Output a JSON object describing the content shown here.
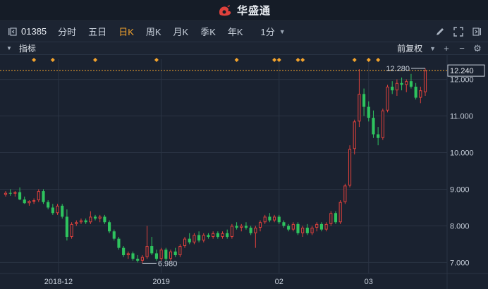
{
  "app": {
    "name": "华盛通"
  },
  "toolbar": {
    "stock_code": "01385",
    "tabs": [
      {
        "label": "分时",
        "active": false
      },
      {
        "label": "五日",
        "active": false
      },
      {
        "label": "日K",
        "active": true
      },
      {
        "label": "周K",
        "active": false
      },
      {
        "label": "月K",
        "active": false
      },
      {
        "label": "季K",
        "active": false
      },
      {
        "label": "年K",
        "active": false
      }
    ],
    "interval": "1分"
  },
  "subbar": {
    "indicator_label": "指标",
    "adjust_label": "前复权"
  },
  "colors": {
    "up": "#e0413c",
    "down": "#2ec35e",
    "accent": "#f3a32c",
    "bg": "#1a2230",
    "grid": "#2a3444"
  },
  "chart_data": {
    "type": "candlestick",
    "ylim": [
      6.7,
      12.55
    ],
    "y_ticks": [
      "12.000",
      "11.000",
      "10.000",
      "9.000",
      "8.000",
      "7.000"
    ],
    "x_ticks": [
      "2018-12",
      "2019",
      "02",
      "03"
    ],
    "current_price": "12.240",
    "max_label": "12.280",
    "min_label": "6.980",
    "candles": [
      [
        8.85,
        8.95,
        8.8,
        8.9
      ],
      [
        8.9,
        9.0,
        8.82,
        8.88
      ],
      [
        8.88,
        8.95,
        8.8,
        8.92
      ],
      [
        8.92,
        9.05,
        8.7,
        8.72
      ],
      [
        8.72,
        8.8,
        8.6,
        8.62
      ],
      [
        8.62,
        8.7,
        8.55,
        8.68
      ],
      [
        8.68,
        8.75,
        8.6,
        8.7
      ],
      [
        8.7,
        9.0,
        8.65,
        8.95
      ],
      [
        8.95,
        9.0,
        8.6,
        8.65
      ],
      [
        8.65,
        8.7,
        8.45,
        8.5
      ],
      [
        8.5,
        8.6,
        8.3,
        8.35
      ],
      [
        8.35,
        8.6,
        8.3,
        8.55
      ],
      [
        8.55,
        8.6,
        8.2,
        8.25
      ],
      [
        8.25,
        8.45,
        7.6,
        7.7
      ],
      [
        7.7,
        8.1,
        7.65,
        8.05
      ],
      [
        8.05,
        8.15,
        8.0,
        8.1
      ],
      [
        8.1,
        8.2,
        8.05,
        8.15
      ],
      [
        8.15,
        8.2,
        8.05,
        8.1
      ],
      [
        8.1,
        8.4,
        8.05,
        8.25
      ],
      [
        8.25,
        8.3,
        8.15,
        8.2
      ],
      [
        8.2,
        8.3,
        8.1,
        8.25
      ],
      [
        8.25,
        8.3,
        8.05,
        8.1
      ],
      [
        8.1,
        8.15,
        7.8,
        7.85
      ],
      [
        7.85,
        7.9,
        7.6,
        7.65
      ],
      [
        7.65,
        7.7,
        7.35,
        7.4
      ],
      [
        7.4,
        7.45,
        7.15,
        7.2
      ],
      [
        7.2,
        7.3,
        7.1,
        7.25
      ],
      [
        7.25,
        7.3,
        7.05,
        7.1
      ],
      [
        7.1,
        7.2,
        7.0,
        7.05
      ],
      [
        7.05,
        7.2,
        6.98,
        7.15
      ],
      [
        7.15,
        8.0,
        7.1,
        7.45
      ],
      [
        7.45,
        7.7,
        7.2,
        7.25
      ],
      [
        7.25,
        7.35,
        7.05,
        7.1
      ],
      [
        7.1,
        7.4,
        7.05,
        7.35
      ],
      [
        7.35,
        7.4,
        7.05,
        7.1
      ],
      [
        7.1,
        7.35,
        7.05,
        7.3
      ],
      [
        7.3,
        7.4,
        7.15,
        7.2
      ],
      [
        7.2,
        7.5,
        7.15,
        7.45
      ],
      [
        7.45,
        7.7,
        7.4,
        7.65
      ],
      [
        7.65,
        7.8,
        7.5,
        7.55
      ],
      [
        7.55,
        7.8,
        7.5,
        7.75
      ],
      [
        7.75,
        7.85,
        7.55,
        7.6
      ],
      [
        7.6,
        7.8,
        7.55,
        7.75
      ],
      [
        7.75,
        7.8,
        7.65,
        7.7
      ],
      [
        7.7,
        7.85,
        7.65,
        7.8
      ],
      [
        7.8,
        7.85,
        7.65,
        7.7
      ],
      [
        7.7,
        7.85,
        7.65,
        7.8
      ],
      [
        7.8,
        7.9,
        7.65,
        7.7
      ],
      [
        7.7,
        8.05,
        7.65,
        8.0
      ],
      [
        8.0,
        8.1,
        7.9,
        7.95
      ],
      [
        7.95,
        8.05,
        7.85,
        8.0
      ],
      [
        8.0,
        8.1,
        7.9,
        7.95
      ],
      [
        7.95,
        8.0,
        7.75,
        7.8
      ],
      [
        7.8,
        8.0,
        7.4,
        7.95
      ],
      [
        7.95,
        8.15,
        7.85,
        8.1
      ],
      [
        8.1,
        8.3,
        8.05,
        8.25
      ],
      [
        8.25,
        8.35,
        8.1,
        8.15
      ],
      [
        8.15,
        8.3,
        8.1,
        8.25
      ],
      [
        8.25,
        8.3,
        8.05,
        8.1
      ],
      [
        8.1,
        8.15,
        7.95,
        8.0
      ],
      [
        8.0,
        8.05,
        7.85,
        7.9
      ],
      [
        7.9,
        8.1,
        7.85,
        8.05
      ],
      [
        8.05,
        8.1,
        7.75,
        7.8
      ],
      [
        7.8,
        8.0,
        7.7,
        7.95
      ],
      [
        7.95,
        8.05,
        7.75,
        7.8
      ],
      [
        7.8,
        8.0,
        7.75,
        7.95
      ],
      [
        7.95,
        8.1,
        7.85,
        8.05
      ],
      [
        8.05,
        8.1,
        7.85,
        7.9
      ],
      [
        7.9,
        8.1,
        7.85,
        8.05
      ],
      [
        8.05,
        8.4,
        8.0,
        8.35
      ],
      [
        8.35,
        8.4,
        8.05,
        8.1
      ],
      [
        8.1,
        8.7,
        8.05,
        8.65
      ],
      [
        8.65,
        9.15,
        8.6,
        9.1
      ],
      [
        9.1,
        10.2,
        9.05,
        10.1
      ],
      [
        10.1,
        10.9,
        9.95,
        10.85
      ],
      [
        10.85,
        12.28,
        10.7,
        11.6
      ],
      [
        11.6,
        11.75,
        11.0,
        11.25
      ],
      [
        11.25,
        11.4,
        10.85,
        10.95
      ],
      [
        10.95,
        11.15,
        10.4,
        10.5
      ],
      [
        10.5,
        10.7,
        10.2,
        10.4
      ],
      [
        10.4,
        11.2,
        10.35,
        11.15
      ],
      [
        11.15,
        11.85,
        11.1,
        11.8
      ],
      [
        11.8,
        11.95,
        11.6,
        11.7
      ],
      [
        11.7,
        12.0,
        11.55,
        11.9
      ],
      [
        11.9,
        12.05,
        11.7,
        11.85
      ],
      [
        11.85,
        12.0,
        11.65,
        11.95
      ],
      [
        11.95,
        12.15,
        11.75,
        11.8
      ],
      [
        11.8,
        11.9,
        11.45,
        11.5
      ],
      [
        11.5,
        11.8,
        11.35,
        11.7
      ],
      [
        11.65,
        12.3,
        11.55,
        12.24
      ]
    ],
    "event_markers": [
      6,
      10,
      19,
      32,
      49,
      57,
      58,
      62,
      63,
      74,
      77,
      79
    ]
  }
}
